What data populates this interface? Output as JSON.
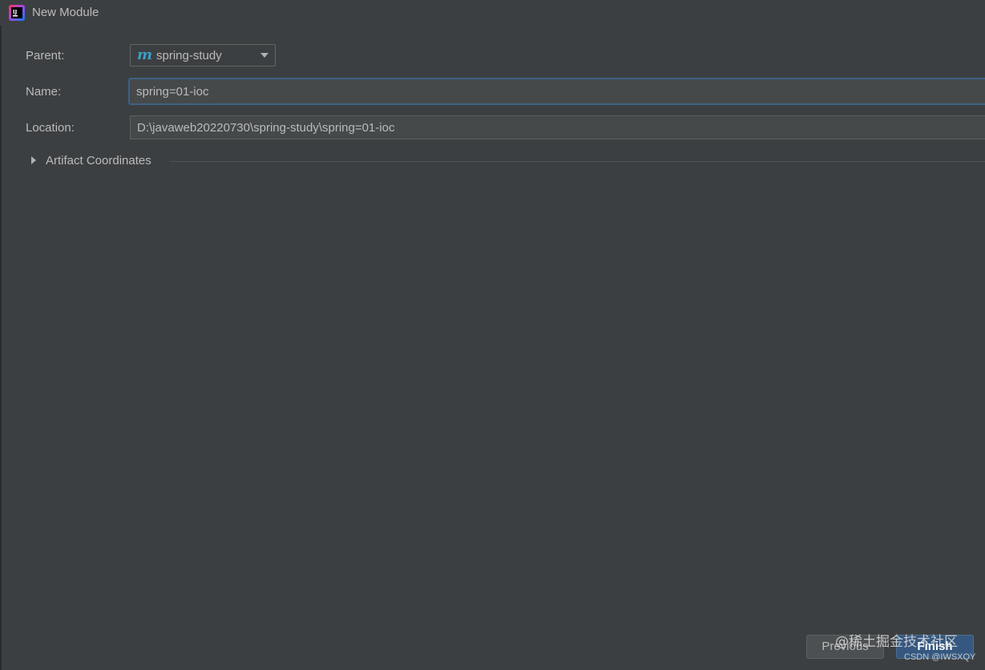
{
  "window": {
    "title": "New Module",
    "app_icon": "intellij-idea-icon"
  },
  "form": {
    "parent": {
      "label": "Parent:",
      "value": "spring-study",
      "icon": "maven-module-icon",
      "icon_glyph": "m"
    },
    "name": {
      "label": "Name:",
      "value": "spring=01-ioc"
    },
    "location": {
      "label": "Location:",
      "value": "D:\\javaweb20220730\\spring-study\\spring=01-ioc"
    }
  },
  "artifact": {
    "label": "Artifact Coordinates",
    "expanded": false
  },
  "buttons": {
    "previous": "Previous",
    "finish": "Finish"
  },
  "watermark": {
    "site": "@稀土掘金技术社区",
    "credit": "CSDN @IWSXQY"
  },
  "colors": {
    "background": "#3c3f41",
    "focus_border": "#3d6185",
    "maven_icon": "#3b9ec9",
    "primary_button": "#365880"
  }
}
